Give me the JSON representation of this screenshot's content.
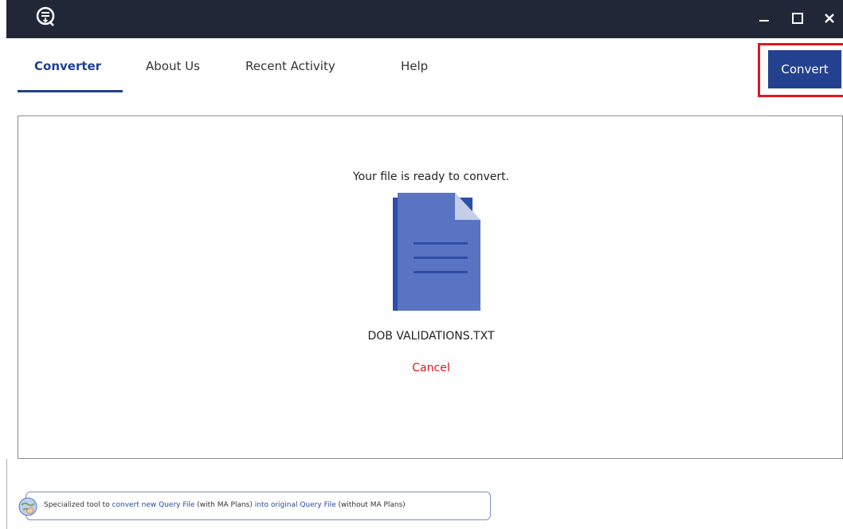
{
  "window": {
    "minimize_icon": "minimize-icon",
    "maximize_icon": "maximize-icon",
    "close_icon": "close-icon",
    "logo_icon": "app-logo-icon"
  },
  "nav": {
    "tabs": [
      {
        "label": "Converter",
        "active": true
      },
      {
        "label": "About Us",
        "active": false
      },
      {
        "label": "Recent Activity",
        "active": false
      },
      {
        "label": "Help",
        "active": false
      }
    ],
    "convert_label": "Convert"
  },
  "main": {
    "status_text": "Your file is ready to convert.",
    "file_name": "DOB VALIDATIONS.TXT",
    "cancel_label": "Cancel",
    "file_icon": "document-icon"
  },
  "footer": {
    "text_1": "Specialized tool to ",
    "link_1": "convert new Query File",
    "text_2": " (with MA Plans) ",
    "link_2": "into original Query File",
    "text_3": " (without MA Plans)"
  },
  "colors": {
    "accent": "#23418f",
    "titlebar": "#222738",
    "highlight": "#e3151e",
    "cancel": "#e3151e"
  }
}
